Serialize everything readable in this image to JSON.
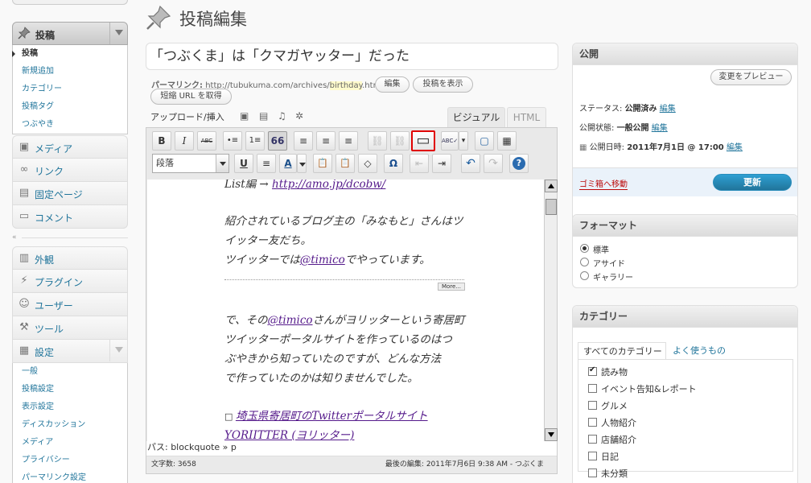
{
  "sidebar": {
    "posts_label": "投稿",
    "posts_sub": [
      "投稿",
      "新規追加",
      "カテゴリー",
      "投稿タグ",
      "つぶやき"
    ],
    "group1": [
      "メディア",
      "リンク",
      "固定ページ",
      "コメント"
    ],
    "group2": [
      "外観",
      "プラグイン",
      "ユーザー",
      "ツール",
      "設定"
    ],
    "settings_sub": [
      "一般",
      "投稿設定",
      "表示設定",
      "ディスカッション",
      "メディア",
      "プライバシー",
      "パーマリンク設定"
    ],
    "separator_glyph": "«"
  },
  "page": {
    "title": "投稿編集"
  },
  "post": {
    "title": "「つぶくま」は「クマガヤッター」だった",
    "permalink_label": "パーマリンク:",
    "permalink_base": "http://tubukuma.com/archives/",
    "permalink_slug": "birthday",
    "permalink_ext": ".html",
    "edit_button": "編集",
    "view_button": "投稿を表示",
    "shortlink_button": "短縮 URL を取得"
  },
  "editor": {
    "upload_label": "アップロード/挿入",
    "tab_visual": "ビジュアル",
    "tab_html": "HTML",
    "format_select": "段落",
    "toolbar1": [
      "B",
      "I",
      "ABC",
      "•≡",
      "1≡",
      "66",
      "≡",
      "≡",
      "≡",
      "⛓",
      "⛓",
      "▭",
      "ABC✓",
      "▾",
      "▢",
      "▦"
    ],
    "toolbar2": [
      "U",
      "≡",
      "A",
      "📋",
      "📋",
      "◇",
      "Ω",
      "⇤",
      "⇥",
      "↶",
      "↷",
      "?"
    ],
    "content": {
      "line0_prefix": "List編 → ",
      "line0_link": "http://amo.jp/dcobw/",
      "line1": "紹介されているブログ主の「みなもと」さんはツ",
      "line2": "イッター友だち。",
      "line3_prefix": "ツイッターでは",
      "line3_link": "@timico",
      "line3_suffix": "でやっています。",
      "more_tag": "More...",
      "line4_prefix": "で、その",
      "line4_link": "@timico",
      "line4_suffix": "さんがヨリッターという寄居町",
      "line5": "ツイッターポータルサイトを作っているのはつ",
      "line6": "ぶやきから知っていたのですが、どんな方法",
      "line7": "で作っていたのかは知りませんでした。",
      "line8_link": "埼玉県寄居町のTwitterポータルサイト",
      "line9_link": "YORIITTER (ヨリッター)"
    },
    "path_label": "パス: blockquote » p",
    "word_count": "文字数: 3658",
    "last_edited": "最後の編集: 2011年7月6日 9:38 AM - つぶくま"
  },
  "publish": {
    "heading": "公開",
    "preview_button": "変更をプレビュー",
    "status_label": "ステータス:",
    "status_value": "公開済み",
    "visibility_label": "公開状態:",
    "visibility_value": "一般公開",
    "date_label": "公開日時:",
    "date_value": "2011年7月1日 @ 17:00",
    "edit_link": "編集",
    "trash_link": "ゴミ箱へ移動",
    "update_button": "更新"
  },
  "format": {
    "heading": "フォーマット",
    "options": [
      "標準",
      "アサイド",
      "ギャラリー"
    ],
    "selected": "標準"
  },
  "categories": {
    "heading": "カテゴリー",
    "tab_all": "すべてのカテゴリー",
    "tab_popular": "よく使うもの",
    "items": [
      "読み物",
      "イベント告知&レポート",
      "グルメ",
      "人物紹介",
      "店舗紹介",
      "日記",
      "未分類"
    ],
    "checked": "読み物"
  },
  "colors": {
    "link": "#21759b",
    "highlight_border": "#e00000",
    "update_button": "#21759b",
    "trash": "#bc0b0b"
  }
}
